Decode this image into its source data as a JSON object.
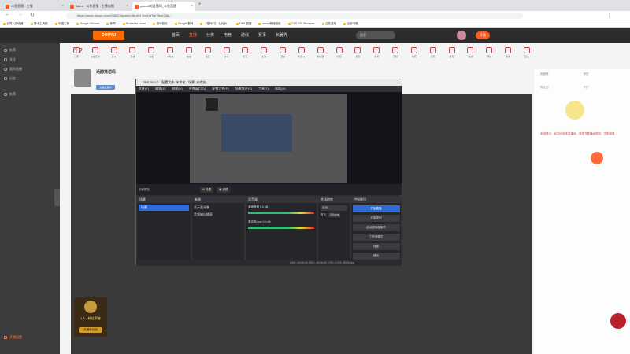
{
  "browser": {
    "tabs": [
      {
        "label": "斗鱼直播 - 主播",
        "favicon_color": "#ff5a1f"
      },
      {
        "label": "Jaunt · 斗鱼直播 - 主播电播",
        "favicon_color": "#ff5a1f"
      },
      {
        "label": "pacroll的直播间_斗鱼直播",
        "favicon_color": "#ff5a1f"
      }
    ],
    "url": "https://www.douyu.com/206023&pskid=6rul04 / beDdTwi79ks/20ls...",
    "bookmarks": [
      "已导入的收藏",
      "赛卡工具箱",
      "中国工商",
      "Google Chrome",
      "新闻",
      "Broken to Learn",
      "游戏首页",
      "Google 翻译",
      "《搜你们》 长元分...",
      "DKK 直播",
      "xahoo伸缩链接",
      "CSS GIS Streamer",
      "正在直播",
      "全部书签"
    ]
  },
  "site": {
    "logo": "DOUYU",
    "nav": [
      "首页",
      "直播",
      "分类",
      "电竞",
      "游戏",
      "赛事",
      "石器界"
    ],
    "search_placeholder": "搜索"
  },
  "sidebar": {
    "items": [
      "推荐",
      "关注",
      "我的直播",
      "历史",
      "推荐"
    ],
    "footer": "开播设置"
  },
  "icon_row": [
    "订阅",
    "主播任务",
    "星斗",
    "直播",
    "等级",
    "小专栏",
    "加速",
    "活跃",
    "分享",
    "红包",
    "礼物",
    "活动",
    "大乱斗",
    "粉丝团",
    "礼包",
    "奖励",
    "时长",
    "竞猜",
    "电竞",
    "道具",
    "更多",
    "抽奖",
    "开播",
    "贵族",
    "设置"
  ],
  "streamer": {
    "name": "话腾落语吗",
    "badge": "主播直播中"
  },
  "count": "12",
  "obs": {
    "title": "OBS 30.0.2 - 配置文件: 未命名 - 场景: 未命名",
    "menu": [
      "文件(F)",
      "编辑(E)",
      "视图(V)",
      "停靠窗口(D)",
      "配置文件(P)",
      "场景集合(S)",
      "工具(T)",
      "帮助(H)"
    ],
    "panels": {
      "scenes": "场景",
      "scene_items": [
        "场景"
      ],
      "sources": "来源",
      "source_items": [
        "显示器采集",
        "音频输出捕获"
      ],
      "mixer": "混音器",
      "mixer_items": [
        "桌面音频 0.0 dB",
        "麦克风/Aux 0.0 dB"
      ],
      "transitions": "转场特效",
      "transition_value": "淡出",
      "duration_label": "时长",
      "duration_value": "300 ms",
      "controls": "控制按钮",
      "control_buttons": [
        "开始直播",
        "开始录制",
        "启动虚拟摄像机",
        "工作室模式",
        "设置",
        "退出"
      ]
    },
    "status": "LIVE: 00:00:00   REC: 00:00:00   CPU: 0.0%, 30.00 fps"
  },
  "donate": {
    "label": "1人 / 粉丝荣誉",
    "sub": "开通粉丝团"
  },
  "colors": {
    "obs_accent": "#2f6ad9",
    "douyu_orange": "#ff5a1f"
  }
}
